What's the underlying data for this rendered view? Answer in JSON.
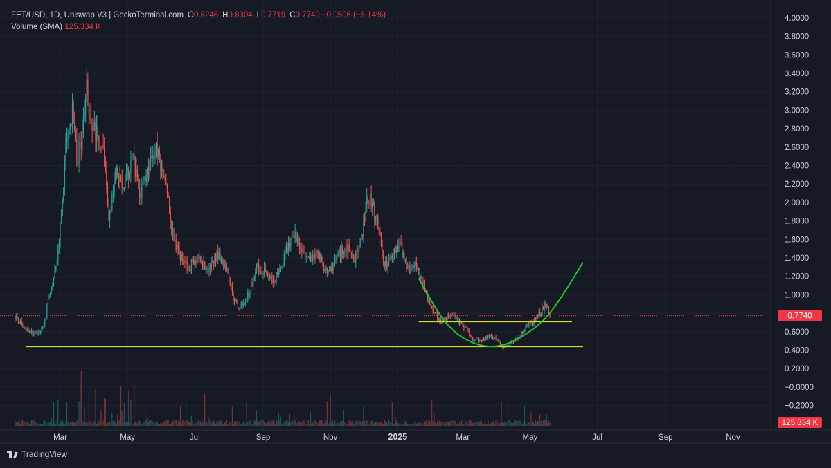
{
  "legend": {
    "title": "FET/USD, 1D, Uniswap V3 | GeckoTerminal.com",
    "o_label": "O",
    "o_value": "0.8246",
    "h_label": "H",
    "h_value": "0.8304",
    "l_label": "L",
    "l_value": "0.7719",
    "c_label": "C",
    "c_value": "0.7740",
    "change": "−0.0506 (−6.14%)",
    "volume_label": "Volume (SMA)",
    "volume_value": "125.334 K"
  },
  "colors": {
    "background": "#161a25",
    "up": "#26a69a",
    "down": "#ef5350",
    "accent_red": "#f23645",
    "yellow_line": "#dcdc1e",
    "green_curve": "#22c52e"
  },
  "brand": {
    "name": "TradingView"
  },
  "chart_data": {
    "type": "candlestick",
    "symbol": "FET/USD",
    "timeframe": "1D",
    "y_axis": {
      "ticks": [
        "4.0000",
        "3.8000",
        "3.6000",
        "3.4000",
        "3.2000",
        "3.0000",
        "2.8000",
        "2.6000",
        "2.4000",
        "2.2000",
        "2.0000",
        "1.8000",
        "1.6000",
        "1.4000",
        "1.2000",
        "1.0000",
        "0.8000",
        "0.6000",
        "0.4000",
        "0.2000",
        "−0.0000",
        "−0.2000"
      ],
      "ylim": [
        -0.35,
        4.1
      ]
    },
    "x_axis": {
      "ticks": [
        "Mar",
        "May",
        "Jul",
        "Sep",
        "Nov",
        "2025",
        "Mar",
        "May",
        "Jul",
        "Sep",
        "Nov"
      ],
      "bold": "2025"
    },
    "price_path": [
      [
        "2024-01-20",
        0.77
      ],
      [
        "2024-01-27",
        0.66
      ],
      [
        "2024-02-05",
        0.58
      ],
      [
        "2024-02-12",
        0.6
      ],
      [
        "2024-02-16",
        0.72
      ],
      [
        "2024-02-21",
        1.05
      ],
      [
        "2024-02-27",
        1.35
      ],
      [
        "2024-03-03",
        2.0
      ],
      [
        "2024-03-06",
        2.7
      ],
      [
        "2024-03-12",
        2.95
      ],
      [
        "2024-03-16",
        2.5
      ],
      [
        "2024-03-20",
        2.6
      ],
      [
        "2024-03-25",
        3.3
      ],
      [
        "2024-03-29",
        2.85
      ],
      [
        "2024-04-04",
        2.75
      ],
      [
        "2024-04-10",
        2.5
      ],
      [
        "2024-04-14",
        1.8
      ],
      [
        "2024-04-20",
        2.35
      ],
      [
        "2024-04-28",
        2.2
      ],
      [
        "2024-05-06",
        2.45
      ],
      [
        "2024-05-13",
        2.1
      ],
      [
        "2024-05-20",
        2.35
      ],
      [
        "2024-05-27",
        2.55
      ],
      [
        "2024-06-05",
        2.2
      ],
      [
        "2024-06-11",
        1.65
      ],
      [
        "2024-06-18",
        1.4
      ],
      [
        "2024-06-25",
        1.3
      ],
      [
        "2024-07-05",
        1.4
      ],
      [
        "2024-07-12",
        1.25
      ],
      [
        "2024-07-22",
        1.45
      ],
      [
        "2024-07-31",
        1.25
      ],
      [
        "2024-08-05",
        0.95
      ],
      [
        "2024-08-10",
        0.87
      ],
      [
        "2024-08-18",
        0.98
      ],
      [
        "2024-08-26",
        1.3
      ],
      [
        "2024-09-05",
        1.22
      ],
      [
        "2024-09-11",
        1.15
      ],
      [
        "2024-09-20",
        1.4
      ],
      [
        "2024-09-28",
        1.65
      ],
      [
        "2024-10-06",
        1.5
      ],
      [
        "2024-10-12",
        1.4
      ],
      [
        "2024-10-20",
        1.45
      ],
      [
        "2024-10-28",
        1.25
      ],
      [
        "2024-11-03",
        1.3
      ],
      [
        "2024-11-09",
        1.45
      ],
      [
        "2024-11-16",
        1.5
      ],
      [
        "2024-11-23",
        1.4
      ],
      [
        "2024-11-30",
        1.65
      ],
      [
        "2024-12-04",
        2.05
      ],
      [
        "2024-12-09",
        2.0
      ],
      [
        "2024-12-14",
        1.75
      ],
      [
        "2024-12-20",
        1.3
      ],
      [
        "2024-12-26",
        1.38
      ],
      [
        "2025-01-03",
        1.58
      ],
      [
        "2025-01-07",
        1.35
      ],
      [
        "2025-01-12",
        1.28
      ],
      [
        "2025-01-17",
        1.32
      ],
      [
        "2025-01-22",
        1.2
      ],
      [
        "2025-01-27",
        1.0
      ],
      [
        "2025-02-03",
        0.8
      ],
      [
        "2025-02-10",
        0.72
      ],
      [
        "2025-02-18",
        0.77
      ],
      [
        "2025-02-25",
        0.7
      ],
      [
        "2025-03-04",
        0.63
      ],
      [
        "2025-03-10",
        0.52
      ],
      [
        "2025-03-17",
        0.5
      ],
      [
        "2025-03-24",
        0.55
      ],
      [
        "2025-03-31",
        0.52
      ],
      [
        "2025-04-07",
        0.43
      ],
      [
        "2025-04-13",
        0.47
      ],
      [
        "2025-04-20",
        0.53
      ],
      [
        "2025-04-27",
        0.65
      ],
      [
        "2025-05-04",
        0.72
      ],
      [
        "2025-05-10",
        0.8
      ],
      [
        "2025-05-15",
        0.9
      ],
      [
        "2025-05-19",
        0.774
      ]
    ],
    "last_price": "0.7740",
    "volume_sma": "125.334 K",
    "annotations": [
      {
        "type": "horizontal_line",
        "price": 0.44,
        "from": "2024-01-30",
        "to": "2025-06-18",
        "color": "#dcdc1e"
      },
      {
        "type": "horizontal_line",
        "price": 0.71,
        "from": "2025-01-20",
        "to": "2025-06-08",
        "color": "#dcdc1e"
      },
      {
        "type": "arc",
        "points": [
          [
            "2025-01-20",
            1.18
          ],
          [
            "2025-02-06",
            0.8
          ],
          [
            "2025-02-24",
            0.56
          ],
          [
            "2025-03-17",
            0.44
          ],
          [
            "2025-04-06",
            0.44
          ],
          [
            "2025-04-26",
            0.56
          ],
          [
            "2025-05-14",
            0.72
          ],
          [
            "2025-05-30",
            0.98
          ],
          [
            "2025-06-18",
            1.35
          ]
        ],
        "color": "#22c52e"
      }
    ],
    "grid": true,
    "legend_position": "top-left"
  }
}
